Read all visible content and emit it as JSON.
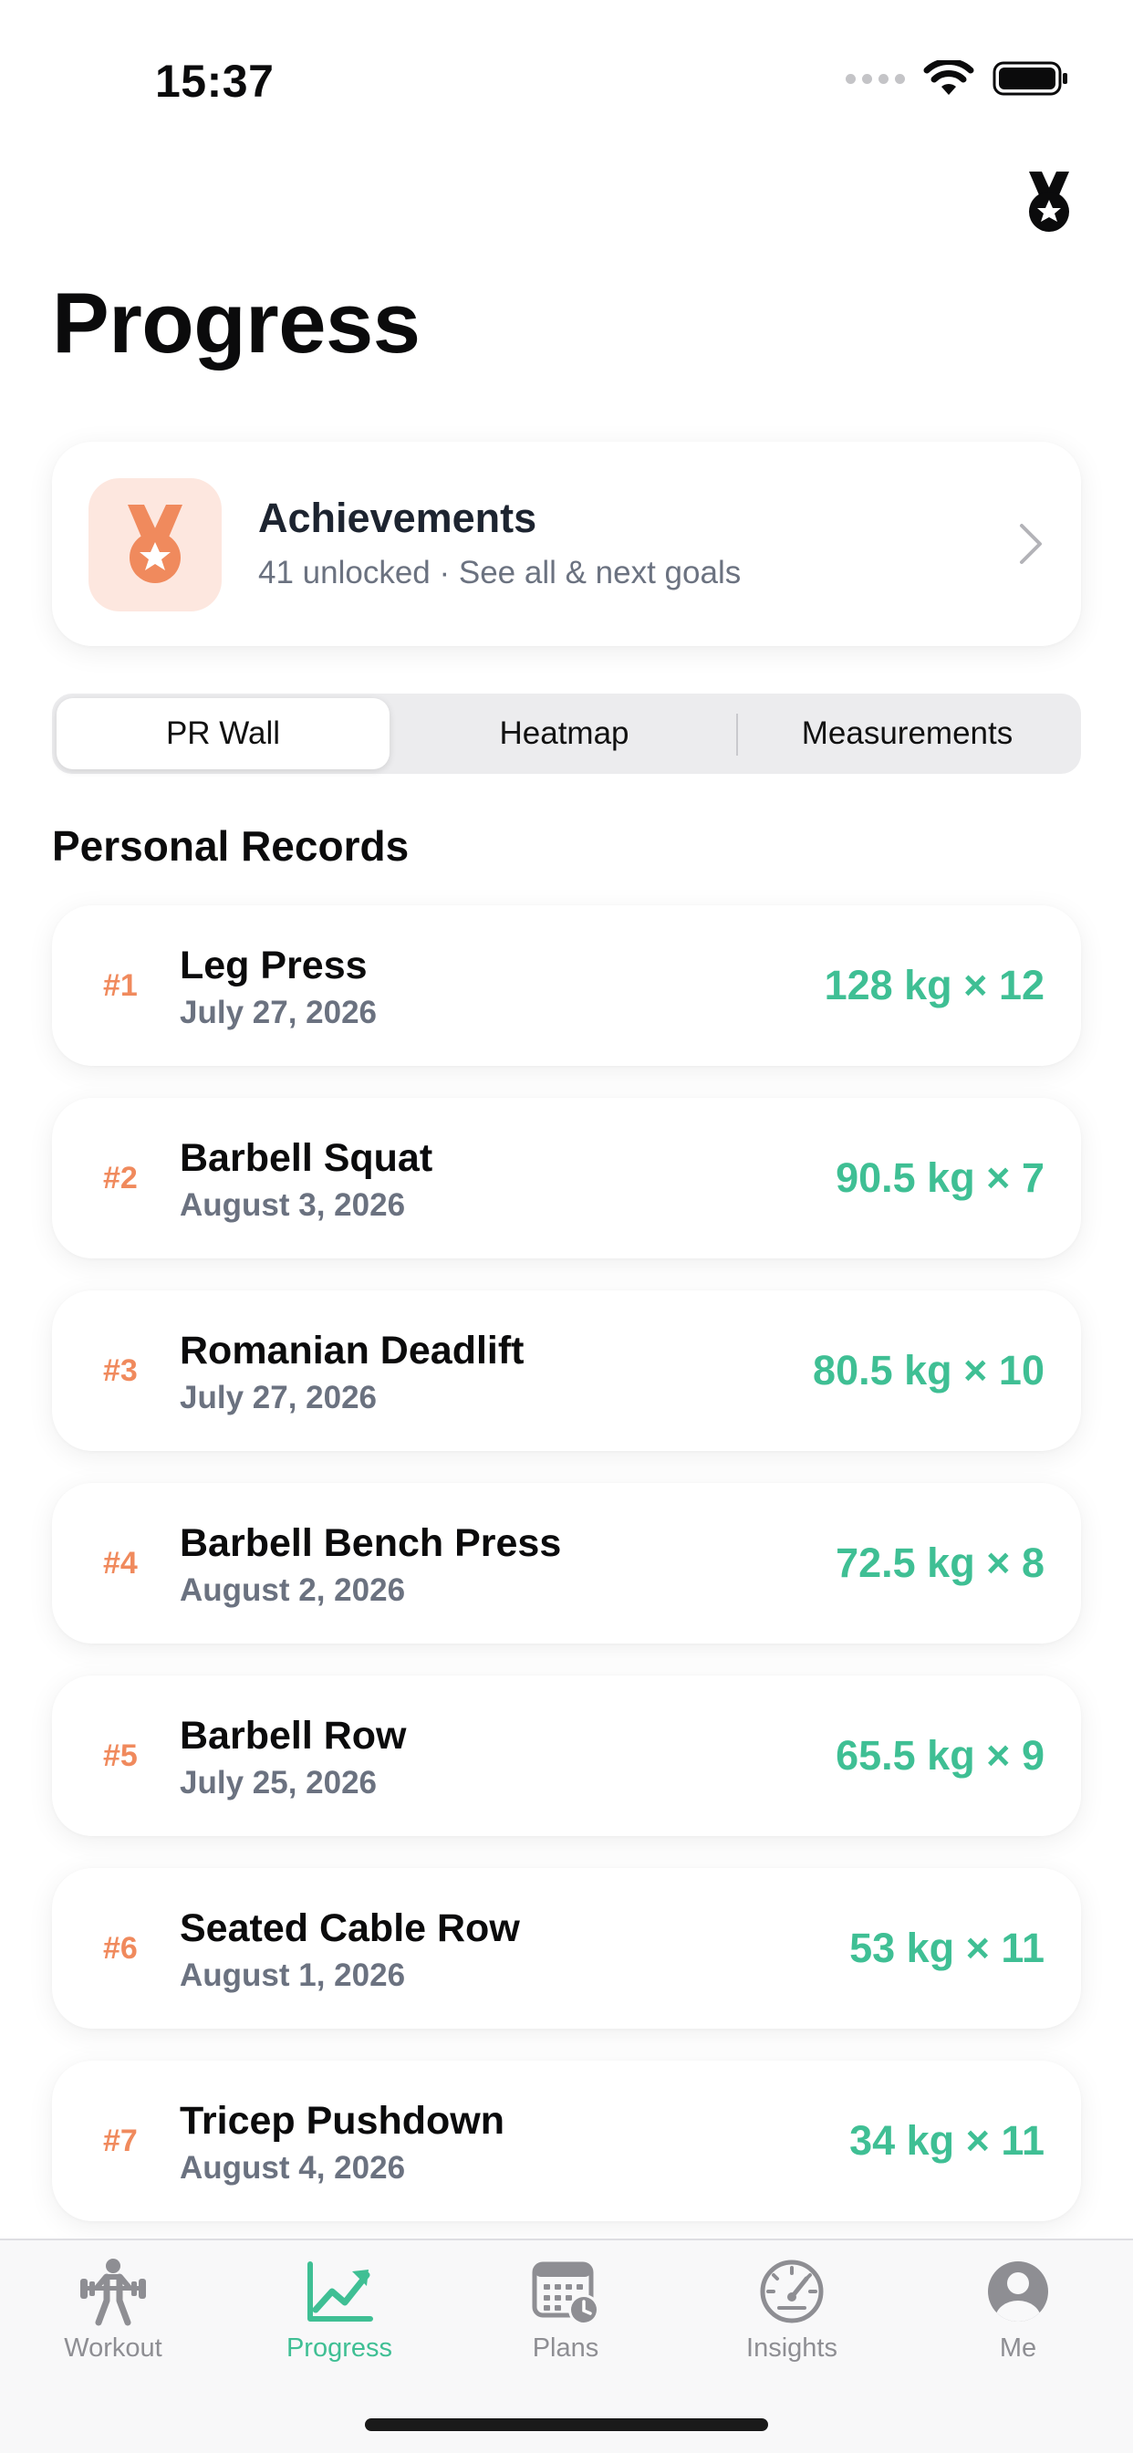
{
  "status_bar": {
    "time": "15:37"
  },
  "header": {
    "title": "Progress",
    "medal_icon": "medal-icon"
  },
  "achievements": {
    "title": "Achievements",
    "subtitle": "41 unlocked · See all & next goals",
    "accent": "#f08a5d"
  },
  "segments": [
    {
      "label": "PR Wall",
      "active": true
    },
    {
      "label": "Heatmap",
      "active": false
    },
    {
      "label": "Measurements",
      "active": false
    }
  ],
  "section_title": "Personal Records",
  "records": [
    {
      "rank": "#1",
      "name": "Leg Press",
      "date": "July 27, 2026",
      "value": "128 kg × 12"
    },
    {
      "rank": "#2",
      "name": "Barbell Squat",
      "date": "August 3, 2026",
      "value": "90.5 kg × 7"
    },
    {
      "rank": "#3",
      "name": "Romanian Deadlift",
      "date": "July 27, 2026",
      "value": "80.5 kg × 10"
    },
    {
      "rank": "#4",
      "name": "Barbell Bench Press",
      "date": "August 2, 2026",
      "value": "72.5 kg × 8"
    },
    {
      "rank": "#5",
      "name": "Barbell Row",
      "date": "July 25, 2026",
      "value": "65.5 kg × 9"
    },
    {
      "rank": "#6",
      "name": "Seated Cable Row",
      "date": "August 1, 2026",
      "value": "53 kg × 11"
    },
    {
      "rank": "#7",
      "name": "Tricep Pushdown",
      "date": "August 4, 2026",
      "value": "34 kg × 11"
    }
  ],
  "tabs": [
    {
      "label": "Workout",
      "icon": "weightlifter-icon",
      "active": false
    },
    {
      "label": "Progress",
      "icon": "chart-line-icon",
      "active": true
    },
    {
      "label": "Plans",
      "icon": "calendar-clock-icon",
      "active": false
    },
    {
      "label": "Insights",
      "icon": "gauge-icon",
      "active": false
    },
    {
      "label": "Me",
      "icon": "person-icon",
      "active": false
    }
  ],
  "colors": {
    "accent_green": "#3fbf94",
    "rank_orange": "#f08a5d",
    "inactive_gray": "#8e8e93"
  }
}
